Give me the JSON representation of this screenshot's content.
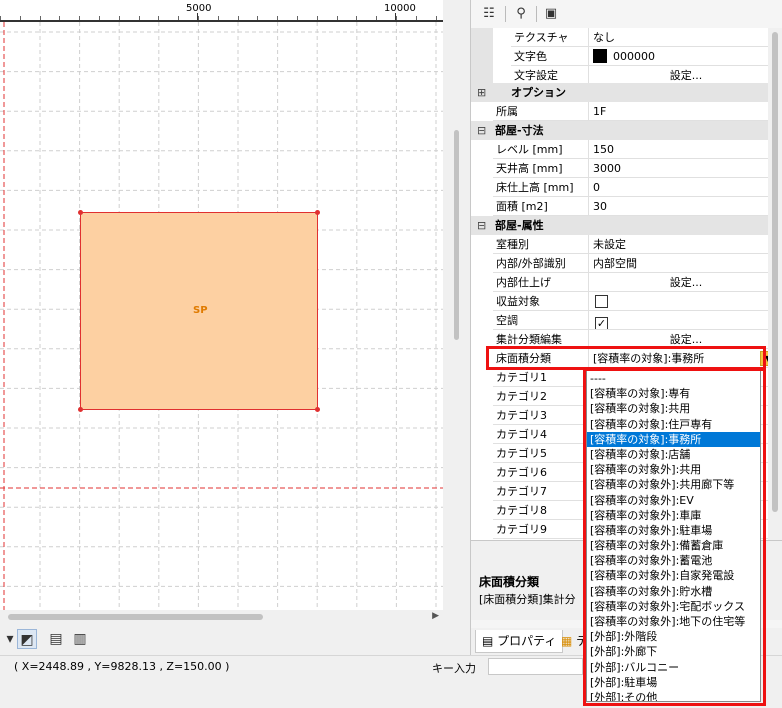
{
  "ruler": {
    "labels": [
      "5000",
      "10000"
    ]
  },
  "room": {
    "label": "SP",
    "fill": "#fdd0a2",
    "border": "#e03030"
  },
  "status": {
    "coords": "( X=2448.89 , Y=9828.13 , Z=150.00 )",
    "key_input_label": "キー入力"
  },
  "properties": {
    "rows_top": [
      {
        "key": "テクスチャ",
        "value": "なし"
      },
      {
        "key": "文字色",
        "value": "000000"
      },
      {
        "key": "文字設定",
        "value": "設定..."
      }
    ],
    "cat_option": "オプション",
    "belong": {
      "key": "所属",
      "value": "1F"
    },
    "cat_dim": "部屋-寸法",
    "dim_rows": [
      {
        "key": "レベル [mm]",
        "value": "150"
      },
      {
        "key": "天井高 [mm]",
        "value": "3000"
      },
      {
        "key": "床仕上高 [mm]",
        "value": "0"
      },
      {
        "key": "面積 [m2]",
        "value": "30"
      }
    ],
    "cat_attr": "部屋-属性",
    "attr_rows": [
      {
        "key": "室種別",
        "value": "未設定"
      },
      {
        "key": "内部/外部識別",
        "value": "内部空間"
      },
      {
        "key": "内部仕上げ",
        "value": "設定..."
      },
      {
        "key": "収益対象",
        "value": ""
      },
      {
        "key": "空調",
        "value": ""
      },
      {
        "key": "集計分類編集",
        "value": "設定..."
      }
    ],
    "checkbox_checked": "✓",
    "floor_area": {
      "key": "床面積分類",
      "value": "[容積率の対象]:事務所"
    },
    "categories": [
      "カテゴリ1",
      "カテゴリ2",
      "カテゴリ3",
      "カテゴリ4",
      "カテゴリ5",
      "カテゴリ6",
      "カテゴリ7",
      "カテゴリ8",
      "カテゴリ9"
    ]
  },
  "description": {
    "title": "床面積分類",
    "body": "[床面積分類]集計分"
  },
  "tabs": {
    "properties": "プロパティ",
    "second": "テ"
  },
  "dropdown": {
    "options": [
      "----",
      "[容積率の対象]:専有",
      "[容積率の対象]:共用",
      "[容積率の対象]:住戸専有",
      "[容積率の対象]:事務所",
      "[容積率の対象]:店舗",
      "[容積率の対象外]:共用",
      "[容積率の対象外]:共用廊下等",
      "[容積率の対象外]:EV",
      "[容積率の対象外]:車庫",
      "[容積率の対象外]:駐車場",
      "[容積率の対象外]:備蓄倉庫",
      "[容積率の対象外]:蓄電池",
      "[容積率の対象外]:自家発電設",
      "[容積率の対象外]:貯水槽",
      "[容積率の対象外]:宅配ボックス",
      "[容積率の対象外]:地下の住宅等",
      "[外部]:外階段",
      "[外部]:外廊下",
      "[外部]:バルコニー",
      "[外部]:駐車場",
      "[外部]:その他"
    ],
    "selected_index": 4
  }
}
